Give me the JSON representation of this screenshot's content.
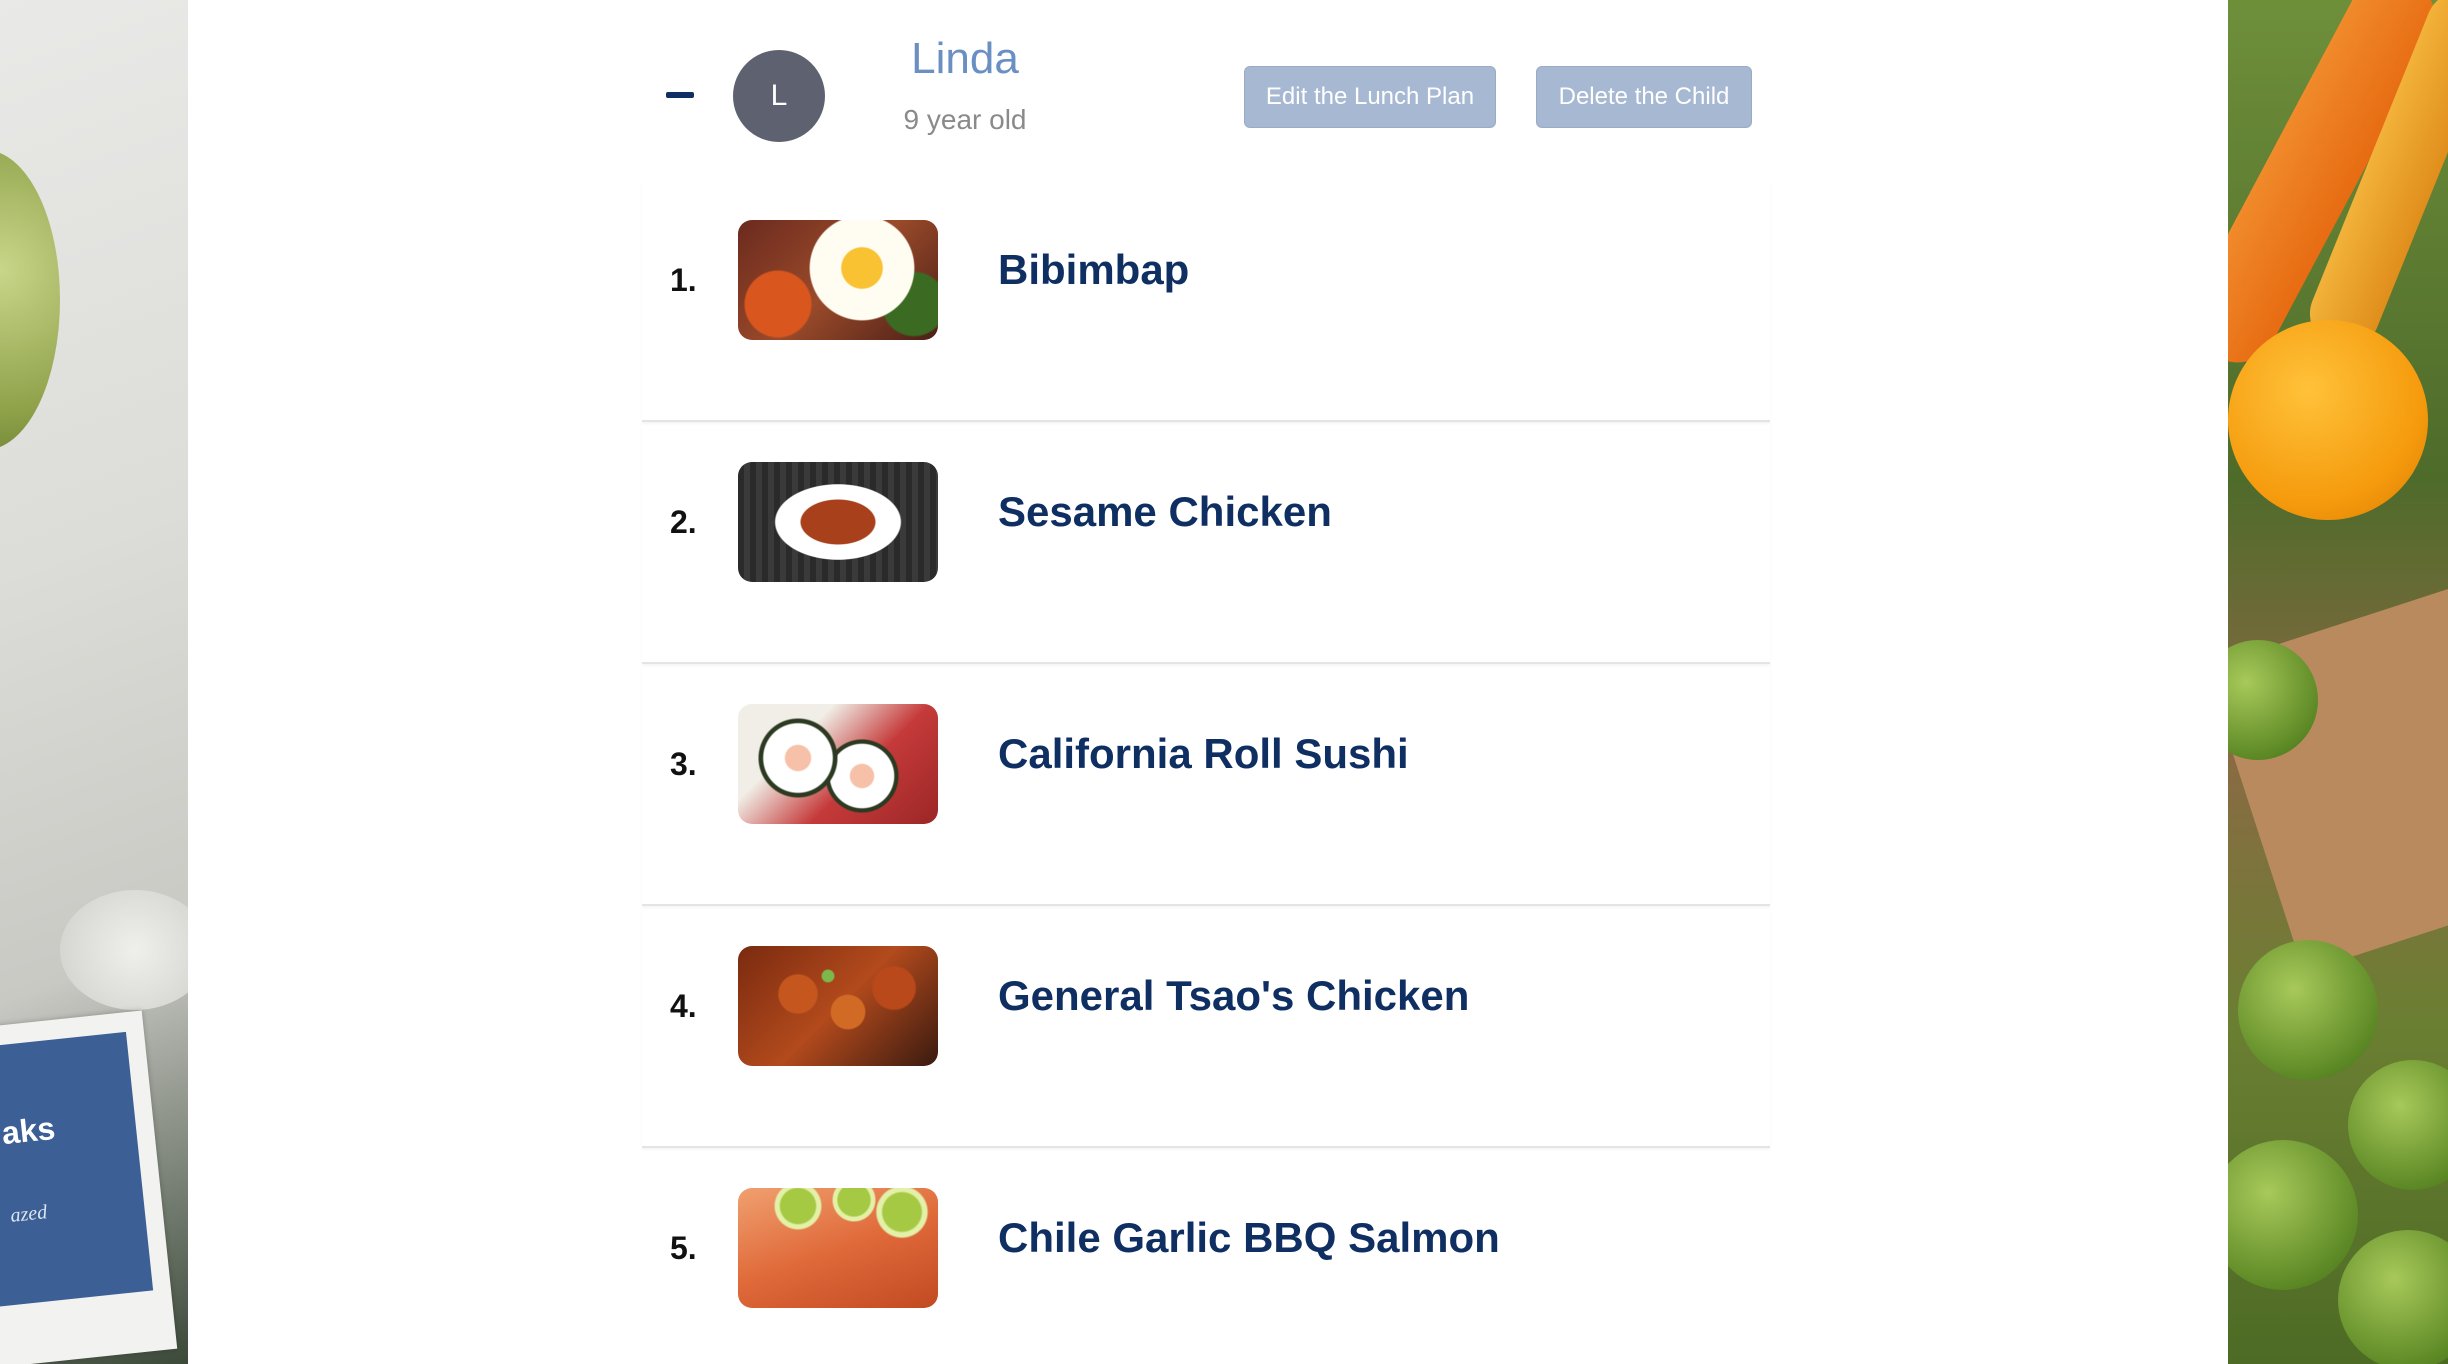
{
  "background": {
    "left_card_text": "aks",
    "left_card_sub": "azed"
  },
  "child": {
    "avatar_initial": "L",
    "name": "Linda",
    "age": "9 year old",
    "edit_button": "Edit the Lunch Plan",
    "delete_button": "Delete the Child"
  },
  "meals": [
    {
      "number": "1.",
      "name": "Bibimbap",
      "image": "bibimbap-photo"
    },
    {
      "number": "2.",
      "name": "Sesame Chicken",
      "image": "sesame-chicken-photo"
    },
    {
      "number": "3.",
      "name": "California Roll Sushi",
      "image": "california-roll-sushi-photo"
    },
    {
      "number": "4.",
      "name": "General Tsao's Chicken",
      "image": "general-tsaos-chicken-photo"
    },
    {
      "number": "5.",
      "name": "Chile Garlic BBQ Salmon",
      "image": "chile-garlic-bbq-salmon-photo"
    }
  ],
  "colors": {
    "name_accent": "#6a8fc2",
    "meal_title": "#0f2f63",
    "button_bg": "#a7b8d2",
    "avatar_bg": "#5e6270"
  }
}
